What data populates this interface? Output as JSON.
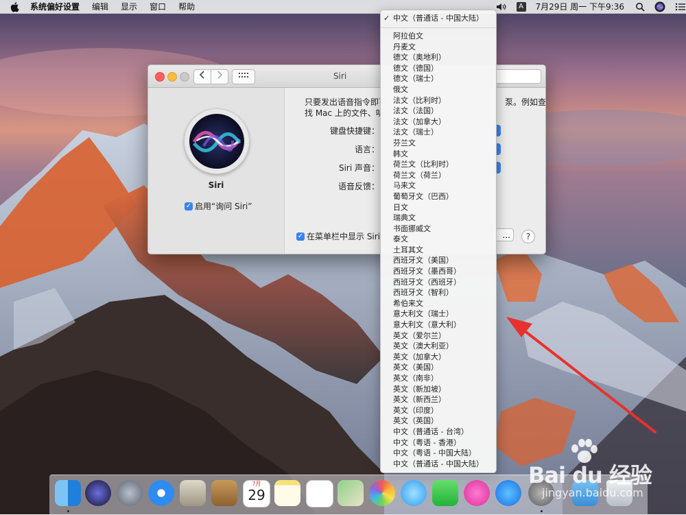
{
  "menubar": {
    "app_name": "系统偏好设置",
    "items": [
      "编辑",
      "显示",
      "窗口",
      "帮助"
    ],
    "input_source": "A",
    "clock": "7月29日 周一 下午9:36"
  },
  "window": {
    "title": "Siri",
    "siri_name": "Siri",
    "enable_label": "启用“询问 Siri”",
    "description_line1": "只要发出语音指令即可",
    "description_line1_end": "泵。例如查",
    "description_line2": "找 Mac 上的文件、听",
    "labels": {
      "shortcut": "键盘快捷键：",
      "language": "语言：",
      "voice": "Siri 声音：",
      "feedback": "语音反馈："
    },
    "menubar_checkbox_label": "在菜单栏中显示 Siri",
    "about_button": "...",
    "help_button": "?"
  },
  "language_menu": {
    "selected_check": "✓",
    "selected": "中文（普通话 - 中国大陆）",
    "options": [
      "阿拉伯文",
      "丹麦文",
      "德文（奥地利）",
      "德文（德国）",
      "德文（瑞士）",
      "俄文",
      "法文（比利时）",
      "法文（法国）",
      "法文（加拿大）",
      "法文（瑞士）",
      "芬兰文",
      "韩文",
      "荷兰文（比利时）",
      "荷兰文（荷兰）",
      "马来文",
      "葡萄牙文（巴西）",
      "日文",
      "瑞典文",
      "书面挪威文",
      "泰文",
      "土耳其文",
      "西班牙文（美国）",
      "西班牙文（墨西哥）",
      "西班牙文（西班牙）",
      "西班牙文（智利）",
      "希伯来文",
      "意大利文（瑞士）",
      "意大利文（意大利）",
      "英文（爱尔兰）",
      "英文（澳大利亚）",
      "英文（加拿大）",
      "英文（美国）",
      "英文（南非）",
      "英文（新加坡）",
      "英文（新西兰）",
      "英文（印度）",
      "英文（英国）",
      "中文（普通话 - 台湾）",
      "中文（粤语 - 香港）",
      "中文（粤语 - 中国大陆）",
      "中文（普通话 - 中国大陆）"
    ]
  },
  "dock": {
    "calendar_month": "7月",
    "calendar_day": "29"
  },
  "watermark": {
    "brand": "Bai du 经验",
    "url": "jingyan.baidu.com"
  }
}
